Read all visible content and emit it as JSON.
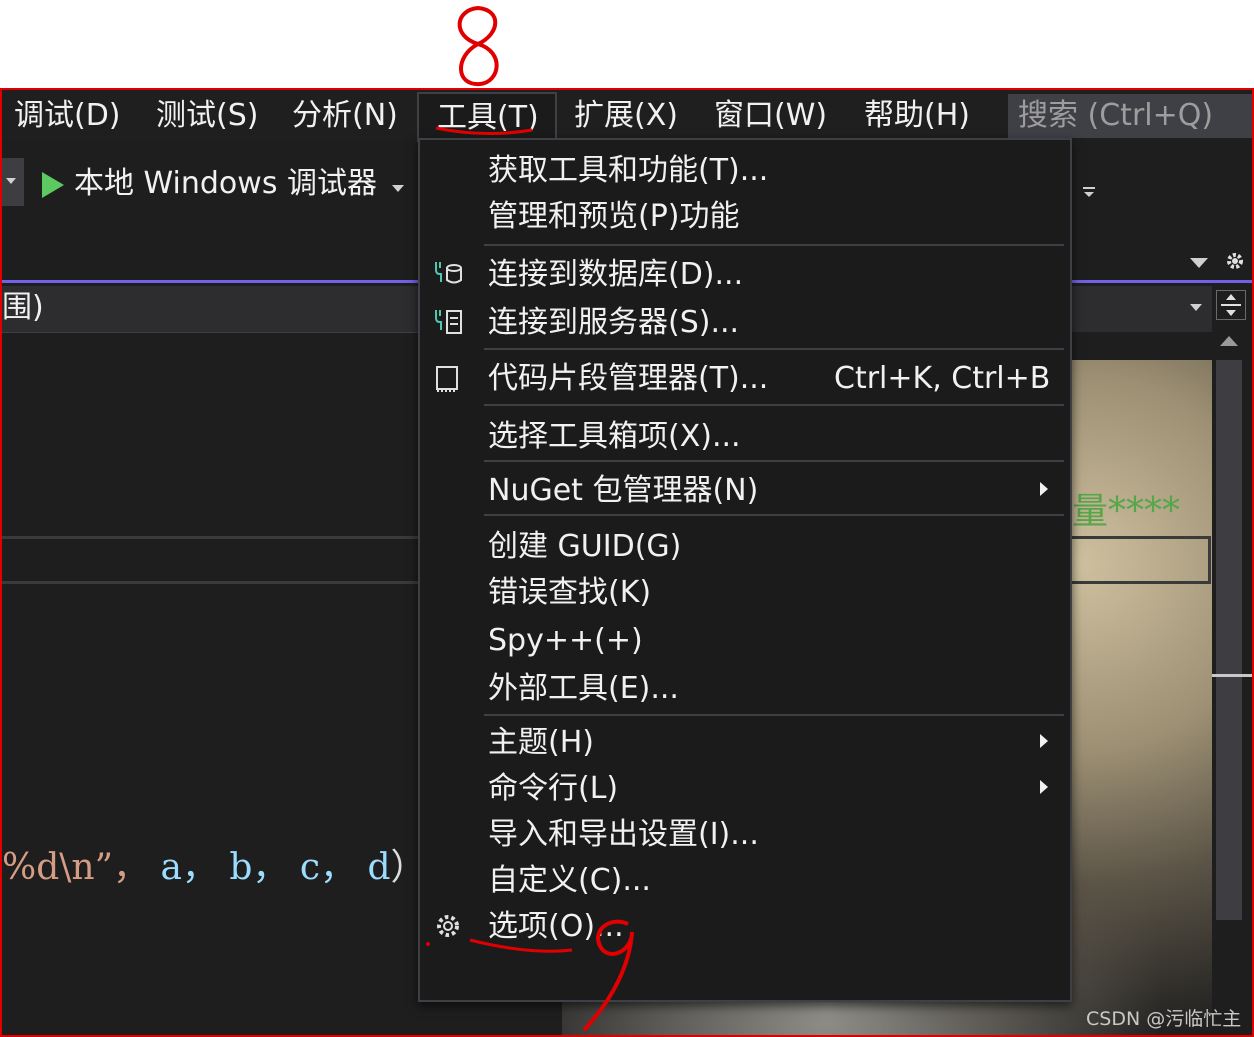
{
  "menubar": {
    "items": [
      {
        "label": "调试(D)"
      },
      {
        "label": "测试(S)"
      },
      {
        "label": "分析(N)"
      },
      {
        "label": "工具(T)"
      },
      {
        "label": "扩展(X)"
      },
      {
        "label": "窗口(W)"
      },
      {
        "label": "帮助(H)"
      }
    ],
    "search_label": "搜索 (Ctrl+Q)"
  },
  "toolbar": {
    "run_label": "本地 Windows 调试器"
  },
  "editor": {
    "scope_label": "围)",
    "comment_text": "量****",
    "code_format": "%d\\n”，",
    "code_args": "a， b， c， d",
    "code_end": "）;"
  },
  "tools_menu": {
    "items": [
      {
        "label": "获取工具和功能(T)..."
      },
      {
        "label": "管理和预览(P)功能"
      },
      {
        "label": "连接到数据库(D)..."
      },
      {
        "label": "连接到服务器(S)..."
      },
      {
        "label": "代码片段管理器(T)...",
        "shortcut": "Ctrl+K, Ctrl+B"
      },
      {
        "label": "选择工具箱项(X)..."
      },
      {
        "label": "NuGet 包管理器(N)"
      },
      {
        "label": "创建 GUID(G)"
      },
      {
        "label": "错误查找(K)"
      },
      {
        "label": "Spy++(+)"
      },
      {
        "label": "外部工具(E)..."
      },
      {
        "label": "主题(H)"
      },
      {
        "label": "命令行(L)"
      },
      {
        "label": "导入和导出设置(I)..."
      },
      {
        "label": "自定义(C)..."
      },
      {
        "label": "选项(O)..."
      }
    ]
  },
  "watermark": "CSDN @污临忙主",
  "colors": {
    "annotation_red": "#e00000",
    "accent_purple": "#7160e8",
    "comment_green": "#57a64a",
    "run_green": "#5dc961"
  }
}
